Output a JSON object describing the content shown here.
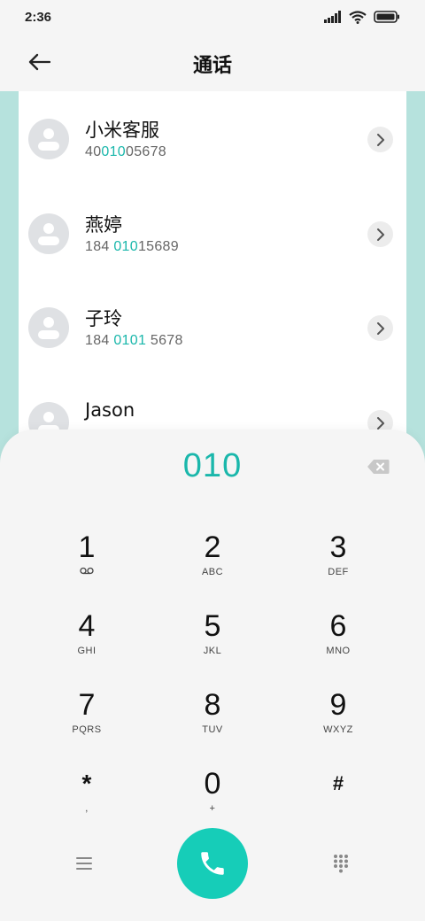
{
  "status_bar": {
    "time": "2:36"
  },
  "header": {
    "title": "通话"
  },
  "contacts": [
    {
      "name": "小米客服",
      "number_parts": [
        "40",
        "010",
        "05678"
      ]
    },
    {
      "name": "燕婷",
      "number_parts": [
        "184 ",
        "010",
        "15689"
      ]
    },
    {
      "name": "子玲",
      "number_parts": [
        "184 ",
        "0101",
        " 5678"
      ]
    },
    {
      "name": "Jason",
      "number_parts": [
        "",
        "",
        ""
      ]
    }
  ],
  "dialpad": {
    "input": "010",
    "keys": [
      {
        "digit": "1",
        "letters": ""
      },
      {
        "digit": "2",
        "letters": "ABC"
      },
      {
        "digit": "3",
        "letters": "DEF"
      },
      {
        "digit": "4",
        "letters": "GHI"
      },
      {
        "digit": "5",
        "letters": "JKL"
      },
      {
        "digit": "6",
        "letters": "MNO"
      },
      {
        "digit": "7",
        "letters": "PQRS"
      },
      {
        "digit": "8",
        "letters": "TUV"
      },
      {
        "digit": "9",
        "letters": "WXYZ"
      },
      {
        "digit": "*",
        "letters": ","
      },
      {
        "digit": "0",
        "letters": "+"
      },
      {
        "digit": "#",
        "letters": ""
      }
    ]
  },
  "colors": {
    "accent": "#1ab7ab",
    "call_button": "#16cdb8",
    "list_background": "#b6e2dd"
  },
  "icons": {
    "back": "arrow-left-icon",
    "signal": "signal-icon",
    "wifi": "wifi-icon",
    "battery": "battery-icon",
    "chevron": "chevron-right-icon",
    "backspace": "backspace-icon",
    "voicemail": "voicemail-icon",
    "menu": "menu-icon",
    "call": "phone-icon",
    "keypad": "dialpad-icon"
  }
}
